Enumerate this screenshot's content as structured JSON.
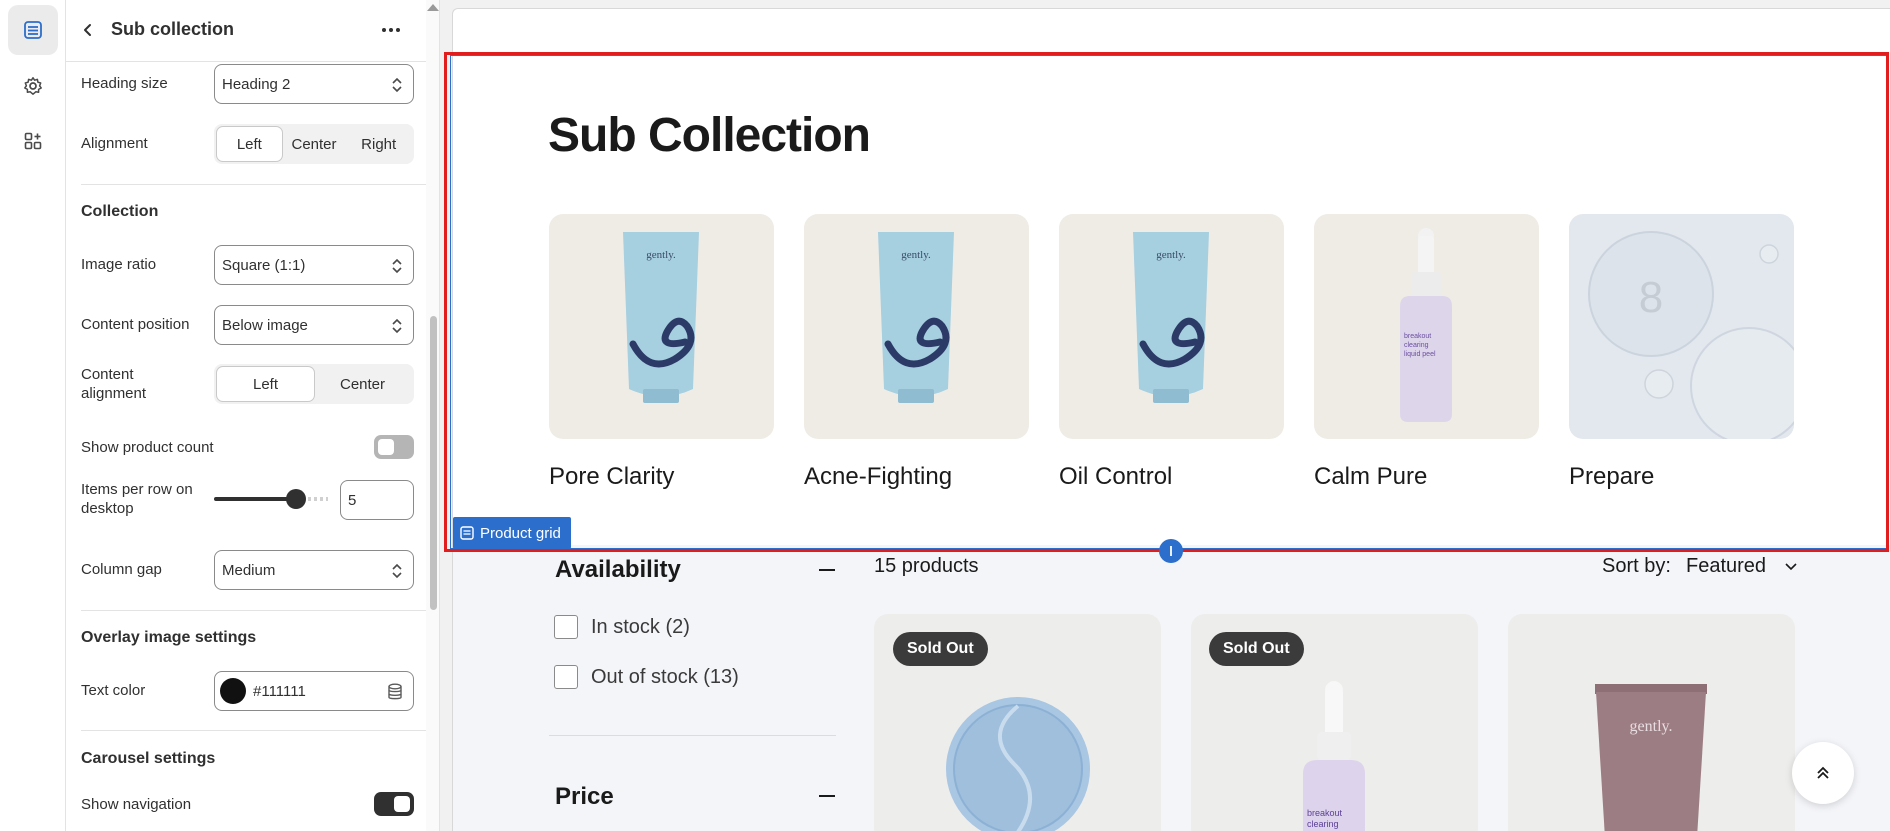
{
  "rail": {
    "items": [
      {
        "icon": "sections-icon",
        "active": true
      },
      {
        "icon": "gear-icon",
        "active": false
      },
      {
        "icon": "apps-icon",
        "active": false
      }
    ]
  },
  "panel": {
    "title": "Sub collection",
    "heading_size": {
      "label": "Heading size",
      "value": "Heading 2"
    },
    "alignment": {
      "label": "Alignment",
      "options": [
        "Left",
        "Center",
        "Right"
      ],
      "selected": "Left"
    },
    "collection_section": "Collection",
    "image_ratio": {
      "label": "Image ratio",
      "value": "Square (1:1)"
    },
    "content_position": {
      "label": "Content position",
      "value": "Below image"
    },
    "content_alignment": {
      "label_line1": "Content",
      "label_line2": "alignment",
      "options": [
        "Left",
        "Center"
      ],
      "selected": "Left"
    },
    "show_product_count": {
      "label": "Show product count",
      "on": false
    },
    "items_per_row": {
      "label_line1": "Items per row on",
      "label_line2": "desktop",
      "value": "5",
      "level": 0.8
    },
    "column_gap": {
      "label": "Column gap",
      "value": "Medium"
    },
    "overlay_section": "Overlay image settings",
    "text_color": {
      "label": "Text color",
      "value": "#111111"
    },
    "carousel_section": "Carousel settings",
    "show_navigation": {
      "label": "Show navigation",
      "on": true
    }
  },
  "preview": {
    "heading": "Sub Collection",
    "collections": [
      {
        "name": "Pore Clarity",
        "image": "blue-tube"
      },
      {
        "name": "Acne-Fighting",
        "image": "blue-tube"
      },
      {
        "name": "Oil Control",
        "image": "blue-tube"
      },
      {
        "name": "Calm Pure",
        "image": "serum-bottle"
      },
      {
        "name": "Prepare",
        "image": "water-drops"
      }
    ],
    "product_grid_tag": "Product grid",
    "filters": {
      "availability_title": "Availability",
      "in_stock": "In stock (2)",
      "out_of_stock": "Out of stock (13)",
      "price_title": "Price"
    },
    "product_count": "15 products",
    "sort_label": "Sort by:",
    "sort_value": "Featured",
    "products": [
      {
        "badge": "Sold Out"
      },
      {
        "badge": "Sold Out"
      },
      {
        "badge": ""
      }
    ]
  },
  "colors": {
    "selection_outline": "#e11d1d",
    "accent_blue": "#2c6ecb",
    "text_color_swatch": "#111111"
  }
}
